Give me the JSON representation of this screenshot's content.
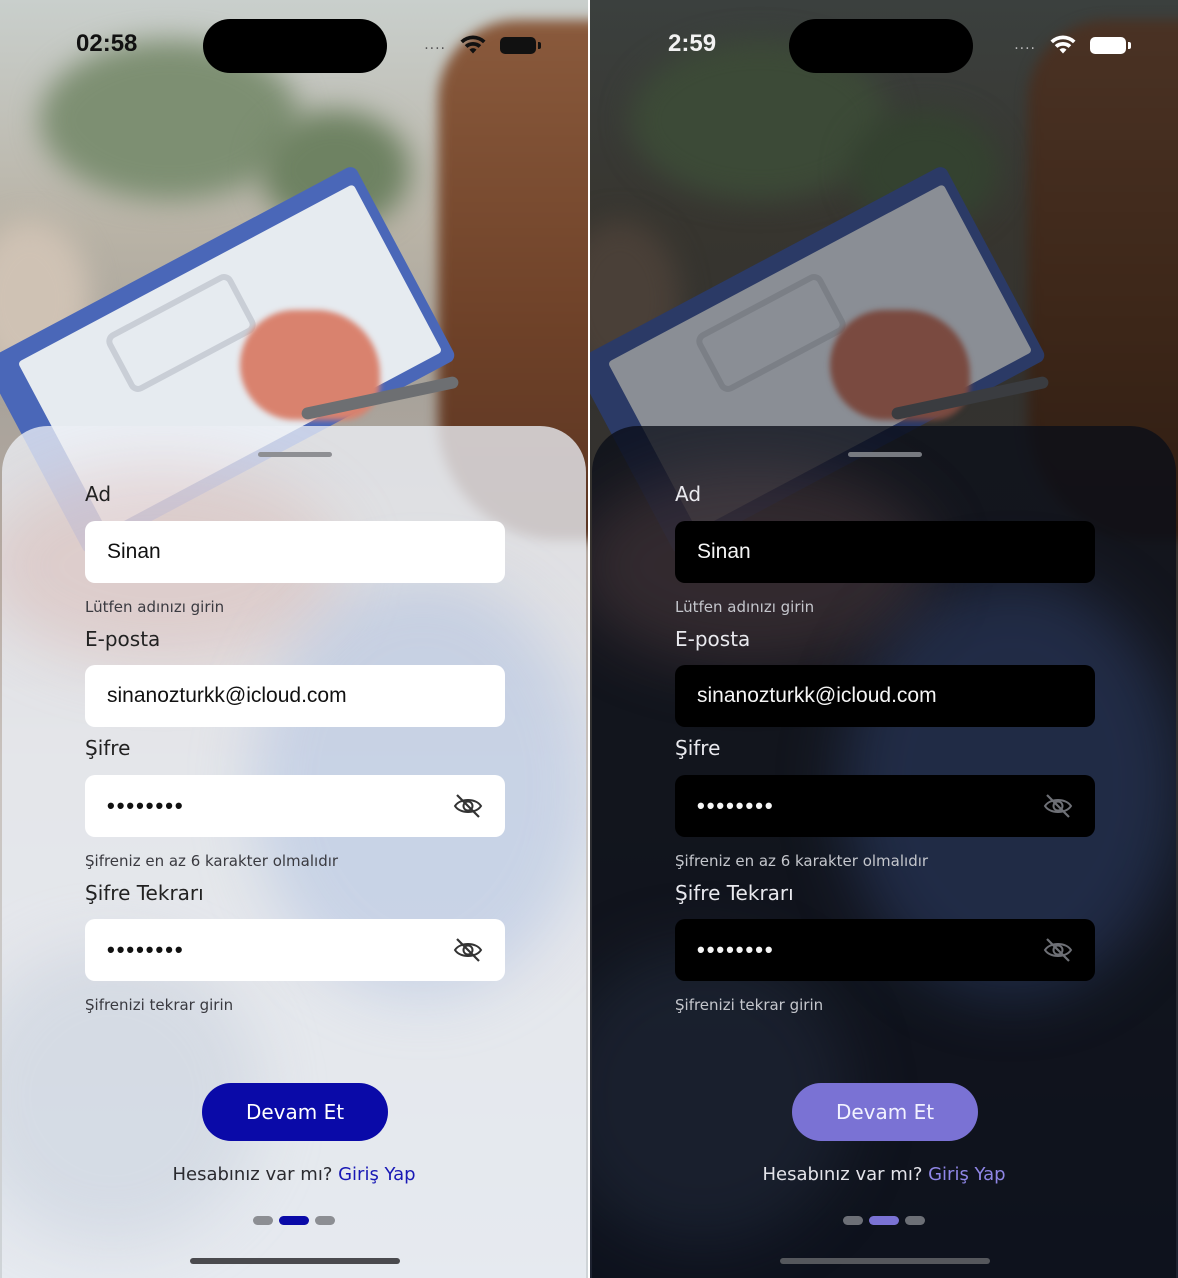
{
  "screens": [
    {
      "theme": "light",
      "status": {
        "time": "02:58",
        "signal": "...."
      },
      "form": {
        "name": {
          "label": "Ad",
          "value": "Sinan",
          "hint": "Lütfen adınızı girin"
        },
        "email": {
          "label": "E-posta",
          "value": "sinanozturkk@icloud.com"
        },
        "password": {
          "label": "Şifre",
          "value": "••••••••",
          "hint": "Şifreniz en az 6 karakter olmalıdır"
        },
        "password_repeat": {
          "label": "Şifre Tekrarı",
          "value": "••••••••",
          "hint": "Şifrenizi tekrar girin"
        }
      },
      "continue_button": "Devam Et",
      "footer": {
        "question": "Hesabınız var mı?",
        "link": "Giriş Yap"
      },
      "page_indicator": {
        "count": 3,
        "active_index": 1
      }
    },
    {
      "theme": "dark",
      "status": {
        "time": "2:59",
        "signal": "...."
      },
      "form": {
        "name": {
          "label": "Ad",
          "value": "Sinan",
          "hint": "Lütfen adınızı girin"
        },
        "email": {
          "label": "E-posta",
          "value": "sinanozturkk@icloud.com"
        },
        "password": {
          "label": "Şifre",
          "value": "••••••••",
          "hint": "Şifreniz en az 6 karakter olmalıdır"
        },
        "password_repeat": {
          "label": "Şifre Tekrarı",
          "value": "••••••••",
          "hint": "Şifrenizi tekrar girin"
        }
      },
      "continue_button": "Devam Et",
      "footer": {
        "question": "Hesabınız var mı?",
        "link": "Giriş Yap"
      },
      "page_indicator": {
        "count": 3,
        "active_index": 1
      }
    }
  ],
  "icons": {
    "wifi": "wifi-icon",
    "battery": "battery-icon",
    "eye_off": "eye-off-icon"
  },
  "colors": {
    "light_accent": "#0a0aa8",
    "dark_accent": "#7a72d4"
  }
}
